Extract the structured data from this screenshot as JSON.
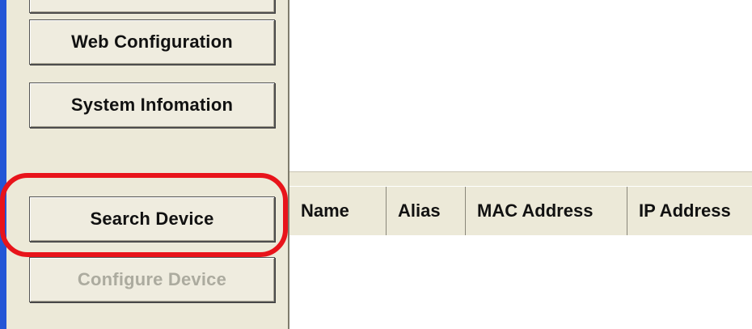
{
  "sidebar": {
    "buttons": [
      {
        "label": "",
        "state": "enabled"
      },
      {
        "label": "Web Configuration",
        "state": "enabled"
      },
      {
        "label": "System Infomation",
        "state": "enabled"
      },
      {
        "label": "Search Device",
        "state": "enabled",
        "highlighted": true
      },
      {
        "label": "Configure Device",
        "state": "disabled"
      }
    ]
  },
  "device_list": {
    "columns": [
      "Name",
      "Alias",
      "MAC Address",
      "IP Address"
    ],
    "rows": []
  },
  "colors": {
    "panel_bg": "#ece9d8",
    "highlight": "#e8141b",
    "window_edge": "#2456d6"
  }
}
